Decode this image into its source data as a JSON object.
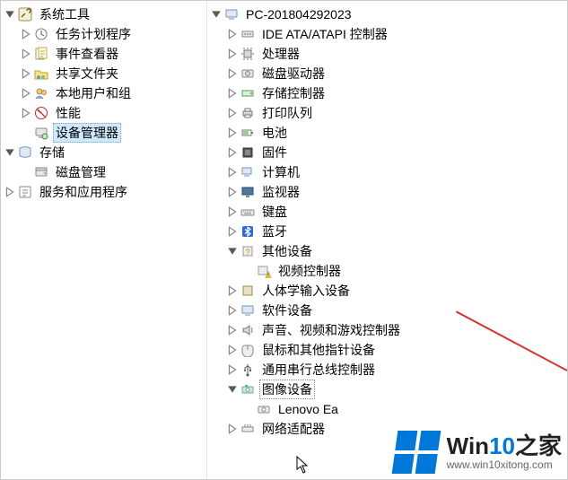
{
  "left_tree": {
    "root": {
      "label": "系统工具",
      "icon": "tools-icon",
      "expanded": true,
      "children": [
        {
          "label": "任务计划程序",
          "icon": "clock-icon",
          "expandable": true
        },
        {
          "label": "事件查看器",
          "icon": "event-icon",
          "expandable": true
        },
        {
          "label": "共享文件夹",
          "icon": "shared-folder-icon",
          "expandable": true
        },
        {
          "label": "本地用户和组",
          "icon": "users-icon",
          "expandable": true
        },
        {
          "label": "性能",
          "icon": "performance-icon",
          "expandable": true
        },
        {
          "label": "设备管理器",
          "icon": "device-manager-icon",
          "expandable": false,
          "selected": true
        }
      ]
    },
    "storage": {
      "label": "存储",
      "icon": "storage-icon",
      "expanded": true,
      "children": [
        {
          "label": "磁盘管理",
          "icon": "disk-icon",
          "expandable": false
        }
      ]
    },
    "services": {
      "label": "服务和应用程序",
      "icon": "services-icon",
      "expandable": true
    }
  },
  "right_tree": {
    "computer": {
      "label": "PC-201804292023",
      "icon": "computer-icon",
      "expanded": true,
      "children": [
        {
          "label": "IDE ATA/ATAPI 控制器",
          "icon": "ide-icon",
          "expandable": true
        },
        {
          "label": "处理器",
          "icon": "cpu-icon",
          "expandable": true
        },
        {
          "label": "磁盘驱动器",
          "icon": "hdd-icon",
          "expandable": true
        },
        {
          "label": "存储控制器",
          "icon": "storage-ctrl-icon",
          "expandable": true
        },
        {
          "label": "打印队列",
          "icon": "printer-icon",
          "expandable": true
        },
        {
          "label": "电池",
          "icon": "battery-icon",
          "expandable": true
        },
        {
          "label": "固件",
          "icon": "firmware-icon",
          "expandable": true
        },
        {
          "label": "计算机",
          "icon": "pc-icon",
          "expandable": true
        },
        {
          "label": "监视器",
          "icon": "monitor-icon",
          "expandable": true
        },
        {
          "label": "键盘",
          "icon": "keyboard-icon",
          "expandable": true
        },
        {
          "label": "蓝牙",
          "icon": "bluetooth-icon",
          "expandable": true
        },
        {
          "label": "其他设备",
          "icon": "other-device-icon",
          "expanded": true,
          "children": [
            {
              "label": "视频控制器",
              "icon": "warning-device-icon",
              "expandable": false
            }
          ]
        },
        {
          "label": "人体学输入设备",
          "icon": "hid-icon",
          "expandable": true
        },
        {
          "label": "软件设备",
          "icon": "software-icon",
          "expandable": true
        },
        {
          "label": "声音、视频和游戏控制器",
          "icon": "sound-icon",
          "expandable": true
        },
        {
          "label": "鼠标和其他指针设备",
          "icon": "mouse-icon",
          "expandable": true
        },
        {
          "label": "通用串行总线控制器",
          "icon": "usb-icon",
          "expandable": true
        },
        {
          "label": "图像设备",
          "icon": "imaging-icon",
          "expanded": true,
          "boxed": true,
          "children": [
            {
              "label": "Lenovo Ea",
              "icon": "camera-icon",
              "expandable": false,
              "truncated": true
            }
          ]
        },
        {
          "label": "网络适配器",
          "icon": "network-icon",
          "expandable": true,
          "truncated": true
        }
      ]
    }
  },
  "watermark": {
    "brand_prefix": "Win",
    "brand_num": "10",
    "brand_suffix": "之家",
    "url": "www.win10xitong.com"
  }
}
